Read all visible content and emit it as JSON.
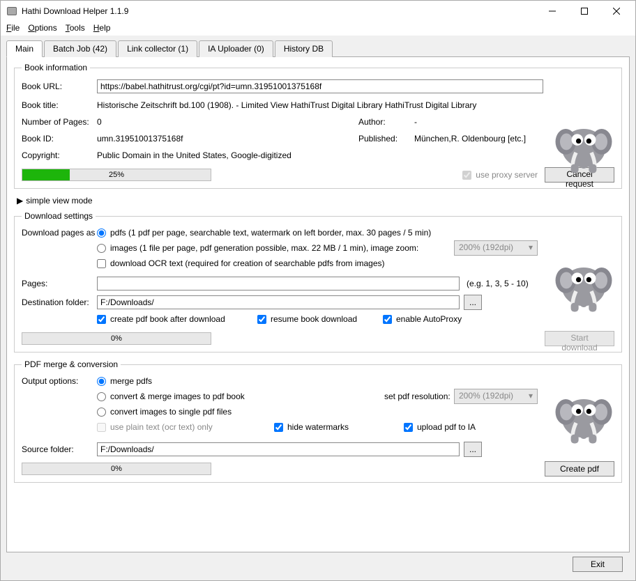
{
  "window": {
    "title": "Hathi Download Helper 1.1.9"
  },
  "menu": {
    "file": "File",
    "options": "Options",
    "tools": "Tools",
    "help": "Help"
  },
  "tabs": {
    "main": "Main",
    "batch": "Batch Job (42)",
    "link": "Link collector (1)",
    "ia": "IA Uploader (0)",
    "history": "History DB"
  },
  "bookinfo": {
    "legend": "Book information",
    "url_label": "Book URL:",
    "url": "https://babel.hathitrust.org/cgi/pt?id=umn.31951001375168f",
    "title_label": "Book title:",
    "title": "Historische Zeitschrift bd.100 (1908). - Limited View  HathiTrust Digital Library  HathiTrust Digital Library",
    "pages_label": "Number of Pages:",
    "pages": "0",
    "author_label": "Author:",
    "author": "-",
    "id_label": "Book ID:",
    "id": "umn.31951001375168f",
    "published_label": "Published:",
    "published": "München,R. Oldenbourg [etc.]",
    "copyright_label": "Copyright:",
    "copyright": "Public Domain in the United States, Google-digitized",
    "progress_text": "25%",
    "progress_pct": 25,
    "proxy_label": "use proxy server",
    "cancel": "Cancel request"
  },
  "simple_view": "simple view mode",
  "dlsettings": {
    "legend": "Download settings",
    "mode_label": "Download pages as",
    "pdfs_label": "pdfs (1 pdf per page, searchable text,  watermark on left border,  max. 30 pages / 5 min)",
    "images_label": "images (1 file per page, pdf generation possible, max. 22 MB / 1 min), image zoom:",
    "zoom": "200% (192dpi)",
    "ocr_label": "download OCR text (required for creation of searchable pdfs from images)",
    "pages_label": "Pages:",
    "pages_hint": "(e.g. 1, 3, 5 - 10)",
    "dest_label": "Destination folder:",
    "dest": "F:/Downloads/",
    "browse": "...",
    "create_pdf_label": "create pdf book after download",
    "resume_label": "resume book download",
    "autoproxy_label": "enable AutoProxy",
    "progress_text": "0%",
    "start": "Start download"
  },
  "pdfmerge": {
    "legend": "PDF merge & conversion",
    "output_label": "Output options:",
    "merge_label": "merge pdfs",
    "convert_merge_label": "convert & merge images to pdf book",
    "set_res_label": "set pdf resolution:",
    "res": "200% (192dpi)",
    "convert_single_label": "convert images to single pdf files",
    "plain_text_label": "use plain text (ocr text) only",
    "hide_wm_label": "hide watermarks",
    "upload_ia_label": "upload pdf to IA",
    "source_label": "Source folder:",
    "source": "F:/Downloads/",
    "browse": "...",
    "progress_text": "0%",
    "create": "Create pdf"
  },
  "footer": {
    "exit": "Exit"
  }
}
